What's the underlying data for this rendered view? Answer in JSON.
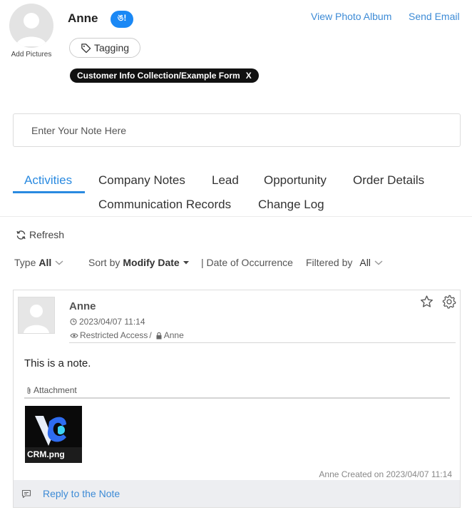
{
  "header": {
    "name": "Anne",
    "wechat_badge": "ঙ!",
    "add_pictures": "Add Pictures",
    "view_album": "View Photo Album",
    "send_email": "Send Email",
    "tagging": "Tagging",
    "form_chip": "Customer Info Collection/Example Form",
    "form_chip_close": "X"
  },
  "note_input": {
    "placeholder": "Enter Your Note Here"
  },
  "tabs": [
    {
      "label": "Activities",
      "active": true
    },
    {
      "label": "Company Notes"
    },
    {
      "label": "Lead"
    },
    {
      "label": "Opportunity"
    },
    {
      "label": "Order Details"
    },
    {
      "label": "Communication Records"
    },
    {
      "label": "Change Log"
    }
  ],
  "toolbar": {
    "refresh": "Refresh",
    "type_label": "Type",
    "type_value": "All",
    "sort_by_label": "Sort by",
    "sort_by_value": "Modify Date",
    "date_label": "| Date of Occurrence",
    "filtered_by_label": "Filtered by",
    "filtered_by_value": "All"
  },
  "activity": {
    "author": "Anne",
    "timestamp": "2023/04/07 11:14",
    "access": "Restricted Access",
    "access_separator": "/",
    "access_user": "Anne",
    "text": "This is a note.",
    "attachment_label": "Attachment",
    "attachment_file": "CRM.png",
    "created_line": "Anne Created on 2023/04/07 11:14",
    "reply": "Reply to the Note"
  },
  "colors": {
    "accent": "#2a8ae0",
    "link": "#3d8bd6",
    "wechat": "#1a88f5"
  }
}
